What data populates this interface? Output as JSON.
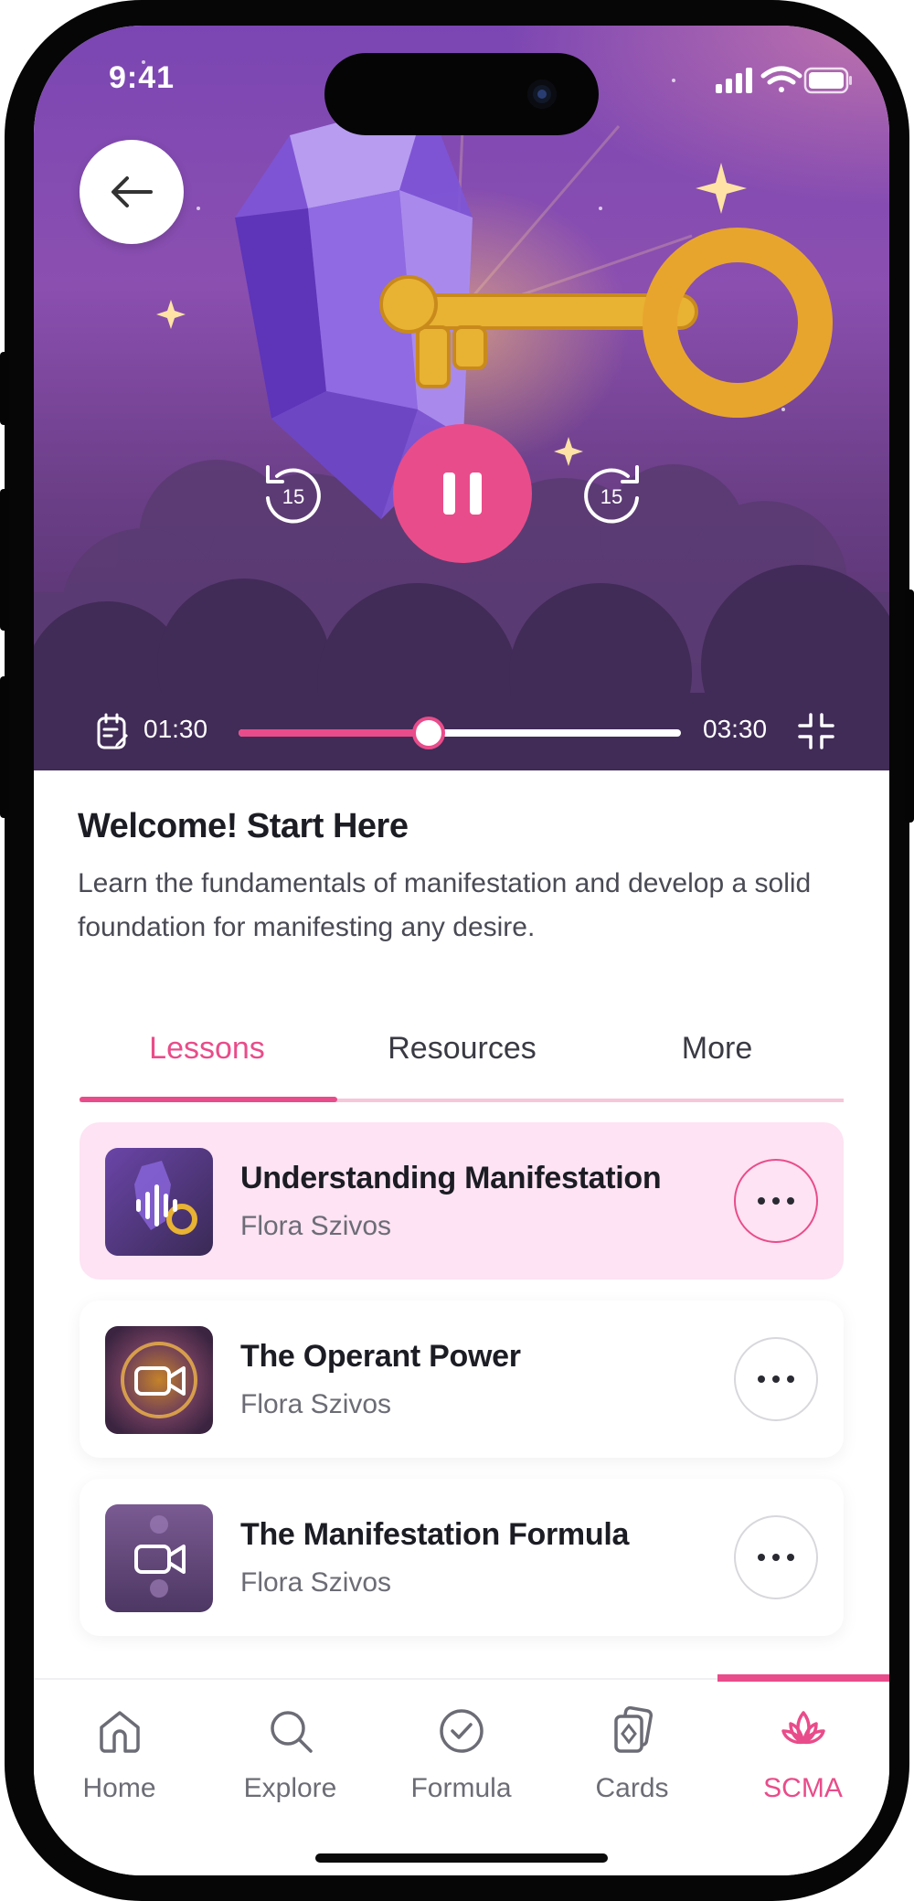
{
  "status_bar": {
    "time": "9:41"
  },
  "player": {
    "elapsed": "01:30",
    "duration": "03:30",
    "progress_fraction": 0.43,
    "skip_back_label": "15",
    "skip_forward_label": "15",
    "accent_color": "#e94c8a"
  },
  "course": {
    "title": "Welcome! Start Here",
    "description": "Learn the fundamentals of manifestation and develop a solid foundation for manifesting any desire."
  },
  "tabs": [
    {
      "label": "Lessons",
      "active": true
    },
    {
      "label": "Resources",
      "active": false
    },
    {
      "label": "More",
      "active": false
    }
  ],
  "lessons": [
    {
      "title": "Understanding Manifestation",
      "author": "Flora Szivos",
      "icon": "audio-wave-icon",
      "active": true
    },
    {
      "title": "The Operant Power",
      "author": "Flora Szivos",
      "icon": "video-camera-icon",
      "active": false
    },
    {
      "title": "The Manifestation Formula",
      "author": "Flora Szivos",
      "icon": "video-camera-icon",
      "active": false
    }
  ],
  "nav": [
    {
      "label": "Home",
      "icon": "home-icon",
      "active": false
    },
    {
      "label": "Explore",
      "icon": "search-icon",
      "active": false
    },
    {
      "label": "Formula",
      "icon": "check-circle-icon",
      "active": false
    },
    {
      "label": "Cards",
      "icon": "cards-icon",
      "active": false
    },
    {
      "label": "SCMA",
      "icon": "lotus-icon",
      "active": true
    }
  ]
}
